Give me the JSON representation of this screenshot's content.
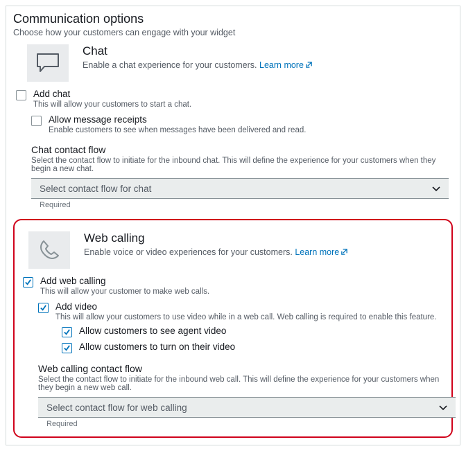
{
  "page": {
    "title": "Communication options",
    "subtitle": "Choose how your customers can engage with your widget"
  },
  "chat": {
    "title": "Chat",
    "desc_prefix": "Enable a chat experience for your customers. ",
    "learn_more": "Learn more",
    "addChat": {
      "label": "Add chat",
      "sub": "This will allow your customers to start a chat.",
      "checked": false
    },
    "receipts": {
      "label": "Allow message receipts",
      "sub": "Enable customers to see when messages have been delivered and read.",
      "checked": false
    },
    "flow": {
      "label": "Chat contact flow",
      "sub": "Select the contact flow to initiate for the inbound chat. This will define the experience for your customers when they begin a new chat.",
      "placeholder": "Select contact flow for chat",
      "required": "Required"
    }
  },
  "web": {
    "title": "Web calling",
    "desc_prefix": "Enable voice or video experiences for your customers. ",
    "learn_more": "Learn more",
    "addWeb": {
      "label": "Add web calling",
      "sub": "This will allow your customer to make web calls.",
      "checked": true
    },
    "addVideo": {
      "label": "Add video",
      "sub": "This will allow your customers to use video while in a web call. Web calling is required to enable this feature.",
      "checked": true
    },
    "seeAgent": {
      "label": "Allow customers to see agent video",
      "checked": true
    },
    "turnOn": {
      "label": "Allow customers to turn on their video",
      "checked": true
    },
    "flow": {
      "label": "Web calling contact flow",
      "sub": "Select the contact flow to initiate for the inbound web call. This will define the experience for your customers when they begin a new web call.",
      "placeholder": "Select contact flow for web calling",
      "required": "Required"
    }
  }
}
